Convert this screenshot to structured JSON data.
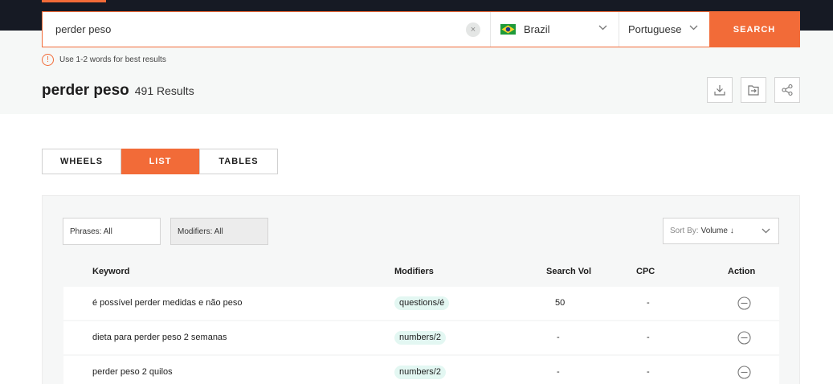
{
  "search": {
    "query": "perder peso",
    "clear_symbol": "×",
    "country": "Brazil",
    "language": "Portuguese",
    "button_label": "SEARCH",
    "hint": "Use 1-2 words for best results",
    "hint_symbol": "!"
  },
  "results": {
    "term": "perder peso",
    "count": "491 Results"
  },
  "views": {
    "wheels": "WHEELS",
    "list": "LIST",
    "tables": "TABLES",
    "active": "list"
  },
  "filters": {
    "phrases": "Phrases: All",
    "modifiers": "Modifiers: All",
    "sort_prefix": "Sort By:",
    "sort_value": "Volume ↓"
  },
  "table": {
    "headers": {
      "keyword": "Keyword",
      "modifiers": "Modifiers",
      "search_vol": "Search Vol",
      "cpc": "CPC",
      "action": "Action"
    },
    "rows": [
      {
        "keyword": "é possível perder medidas e não peso",
        "modifier": "questions/é",
        "volume": "50",
        "cpc": "-"
      },
      {
        "keyword": "dieta para perder peso 2 semanas",
        "modifier": "numbers/2",
        "volume": "-",
        "cpc": "-"
      },
      {
        "keyword": "perder peso 2 quilos",
        "modifier": "numbers/2",
        "volume": "-",
        "cpc": "-"
      }
    ]
  },
  "colors": {
    "accent": "#f26b38",
    "header_bg": "#161a24",
    "tag_bg": "#e3f7f2"
  },
  "icons": {
    "clear": "close-icon",
    "download": "download-icon",
    "export": "export-icon",
    "share": "share-icon",
    "action": "minus-circle-icon",
    "dropdown": "chevron-down-icon"
  }
}
